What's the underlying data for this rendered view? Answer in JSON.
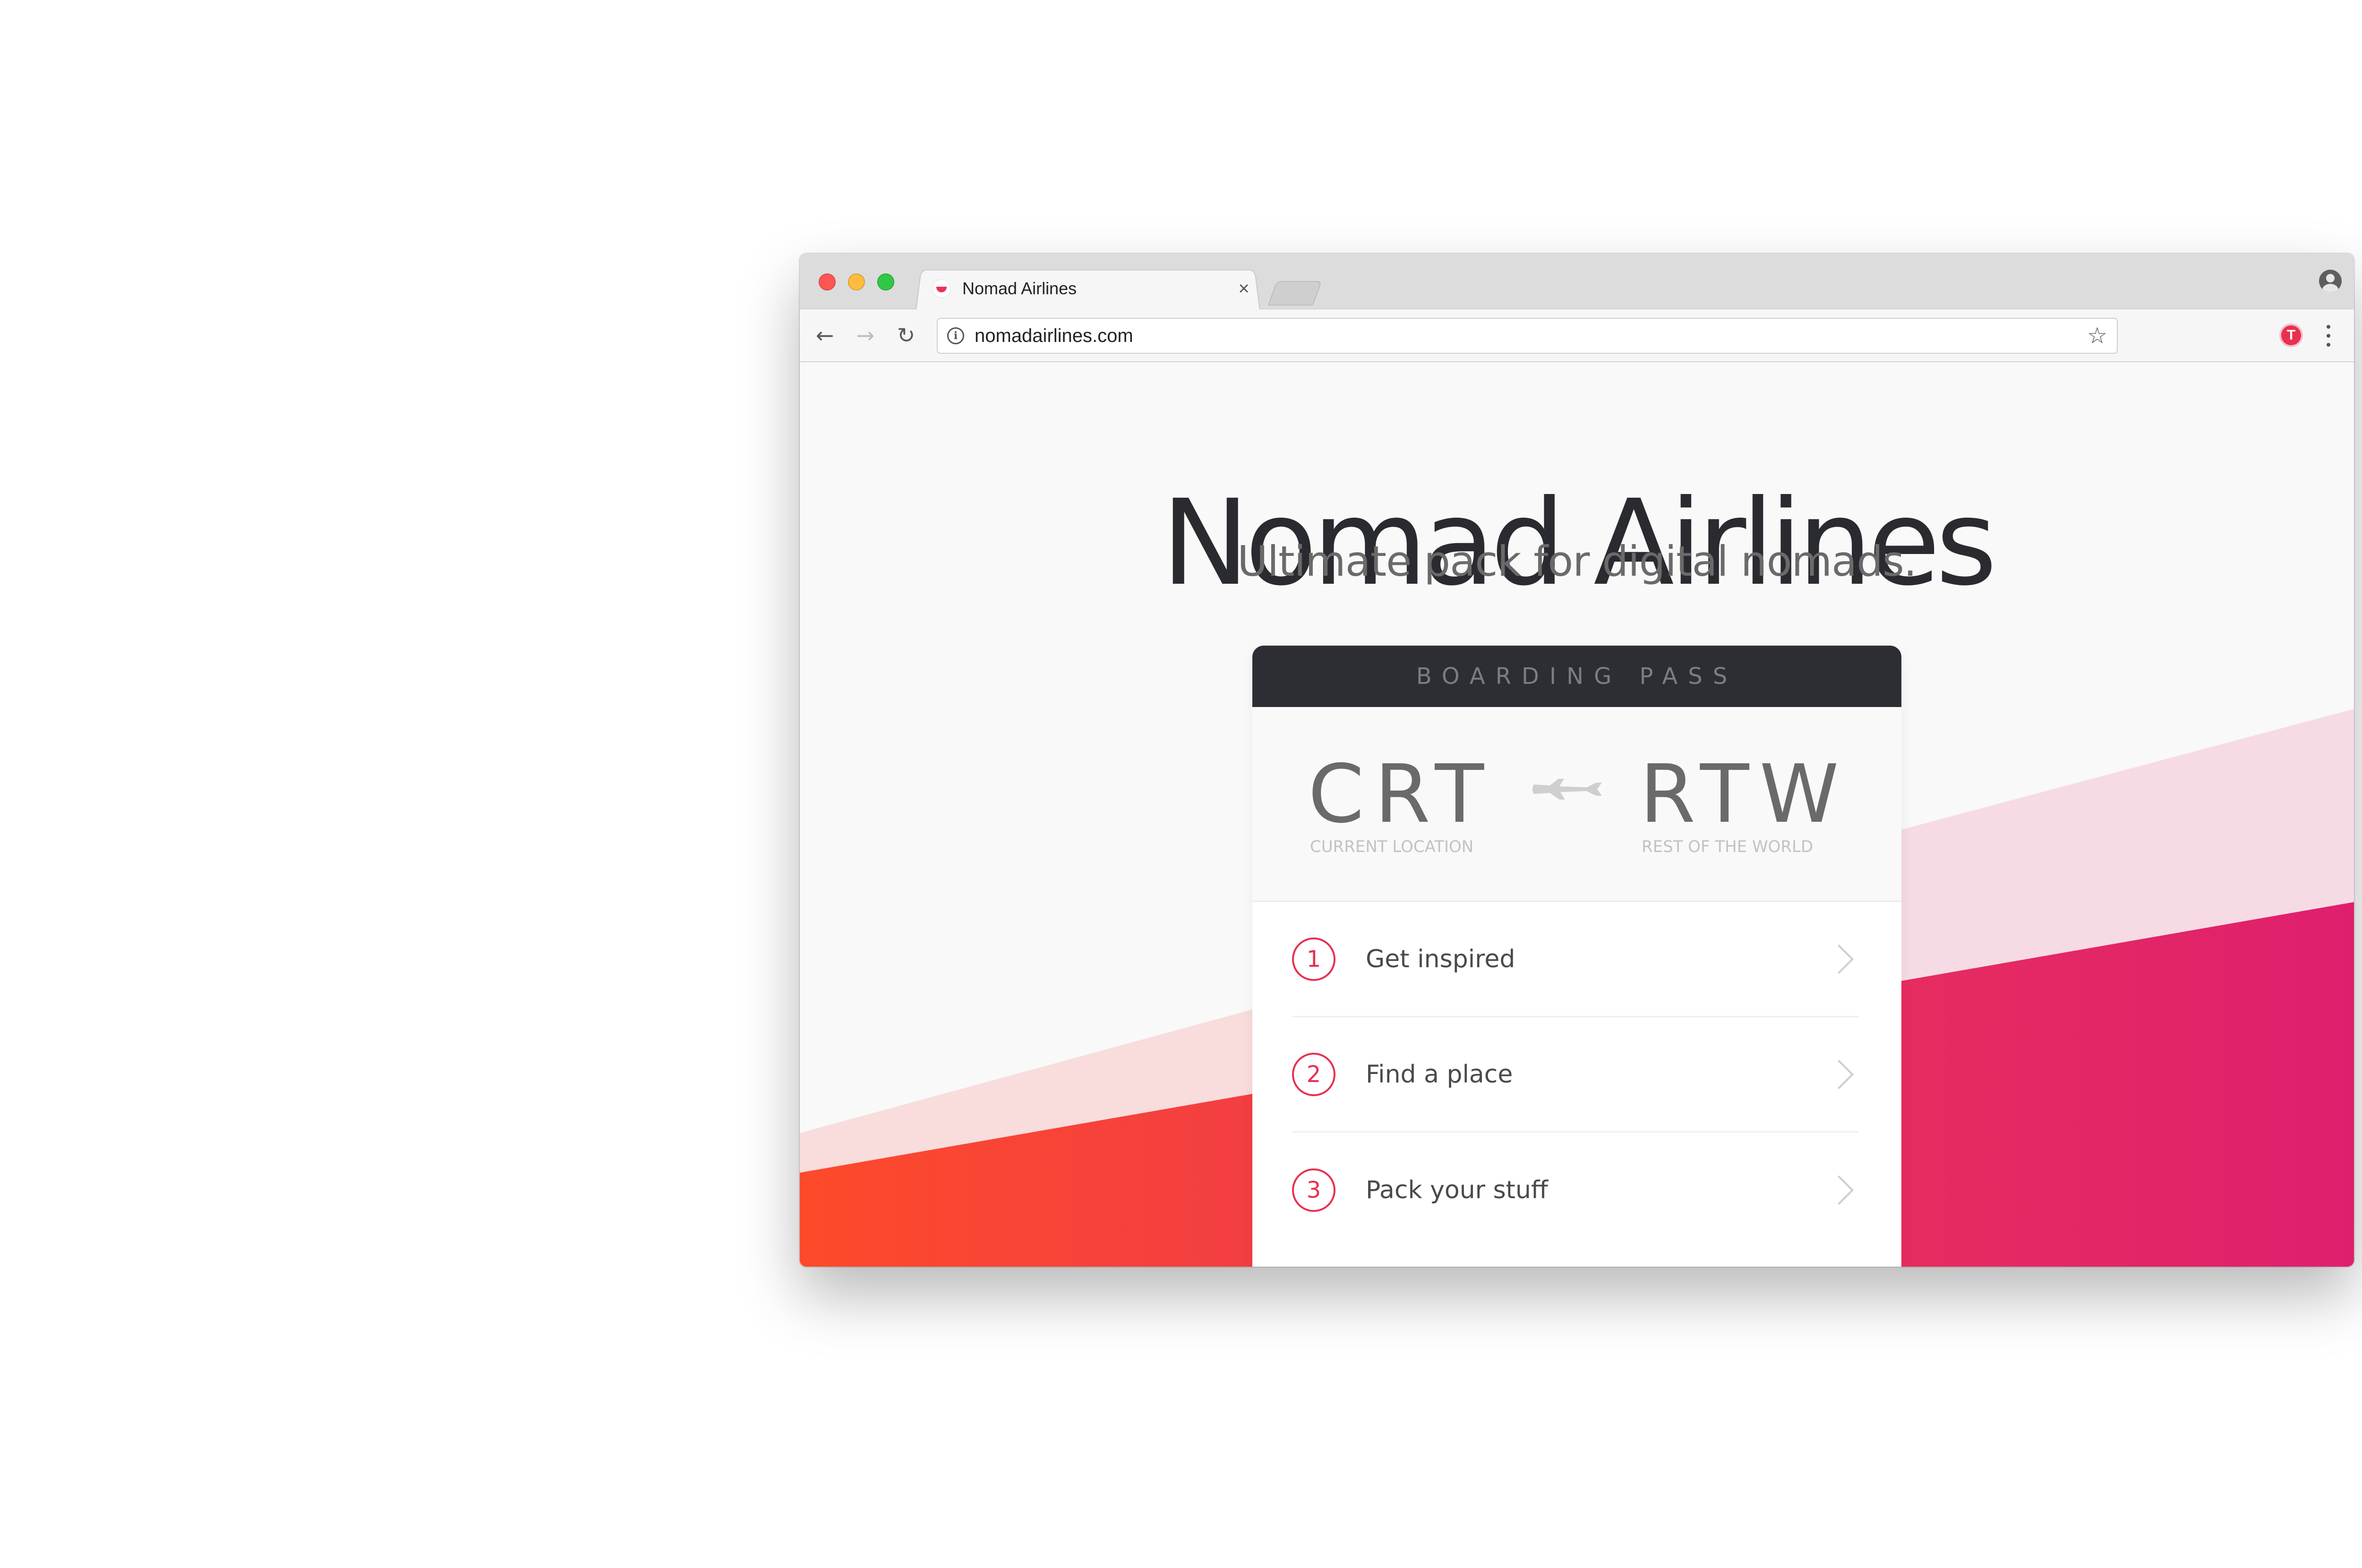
{
  "browser": {
    "tab": {
      "title": "Nomad Airlines",
      "close_glyph": "×"
    },
    "toolbar": {
      "back_glyph": "←",
      "forward_glyph": "→",
      "reload_glyph": "↻",
      "info_glyph": "i",
      "url": "nomadairlines.com",
      "star_glyph": "☆",
      "extension_letter": "T"
    },
    "icons": {
      "traffic_lights": [
        "close-icon",
        "minimize-icon",
        "maximize-icon"
      ],
      "profile": "profile-icon",
      "menu": "more-vert-icon"
    }
  },
  "page": {
    "title": "Nomad Airlines",
    "subtitle": "Ultimate pack for digital nomads.",
    "boarding_pass": {
      "header": "BOARDING PASS",
      "from": {
        "code": "CRT",
        "label": "CURRENT LOCATION"
      },
      "to": {
        "code": "RTW",
        "label": "REST OF THE WORLD"
      },
      "steps": [
        {
          "number": "1",
          "label": "Get inspired"
        },
        {
          "number": "2",
          "label": "Find a place"
        },
        {
          "number": "3",
          "label": "Pack your stuff"
        }
      ]
    },
    "colors": {
      "accent": "#e8304f",
      "gradient_start": "#fd4a2a",
      "gradient_end": "#df1f6e",
      "band_light_left": "#f9dcdc",
      "band_light_right": "#f7dbe4",
      "dark": "#2d2e33"
    }
  }
}
